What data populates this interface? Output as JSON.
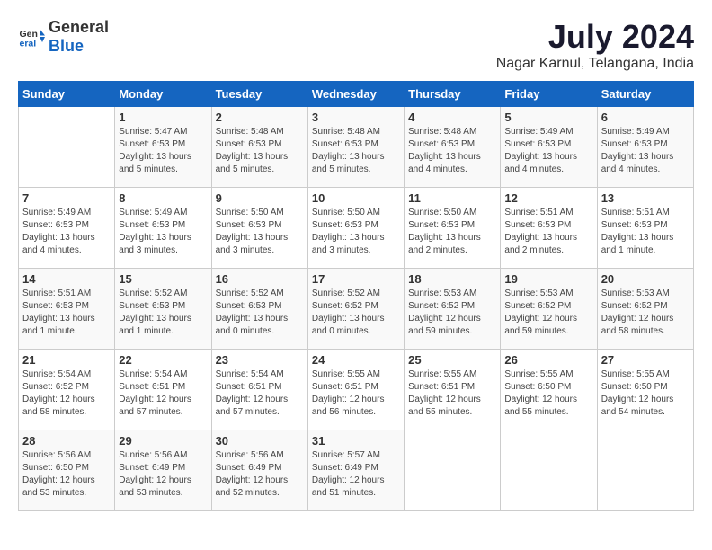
{
  "header": {
    "logo_general": "General",
    "logo_blue": "Blue",
    "month": "July 2024",
    "location": "Nagar Karnul, Telangana, India"
  },
  "weekdays": [
    "Sunday",
    "Monday",
    "Tuesday",
    "Wednesday",
    "Thursday",
    "Friday",
    "Saturday"
  ],
  "weeks": [
    [
      {
        "day": "",
        "info": ""
      },
      {
        "day": "1",
        "info": "Sunrise: 5:47 AM\nSunset: 6:53 PM\nDaylight: 13 hours\nand 5 minutes."
      },
      {
        "day": "2",
        "info": "Sunrise: 5:48 AM\nSunset: 6:53 PM\nDaylight: 13 hours\nand 5 minutes."
      },
      {
        "day": "3",
        "info": "Sunrise: 5:48 AM\nSunset: 6:53 PM\nDaylight: 13 hours\nand 5 minutes."
      },
      {
        "day": "4",
        "info": "Sunrise: 5:48 AM\nSunset: 6:53 PM\nDaylight: 13 hours\nand 4 minutes."
      },
      {
        "day": "5",
        "info": "Sunrise: 5:49 AM\nSunset: 6:53 PM\nDaylight: 13 hours\nand 4 minutes."
      },
      {
        "day": "6",
        "info": "Sunrise: 5:49 AM\nSunset: 6:53 PM\nDaylight: 13 hours\nand 4 minutes."
      }
    ],
    [
      {
        "day": "7",
        "info": "Sunrise: 5:49 AM\nSunset: 6:53 PM\nDaylight: 13 hours\nand 4 minutes."
      },
      {
        "day": "8",
        "info": "Sunrise: 5:49 AM\nSunset: 6:53 PM\nDaylight: 13 hours\nand 3 minutes."
      },
      {
        "day": "9",
        "info": "Sunrise: 5:50 AM\nSunset: 6:53 PM\nDaylight: 13 hours\nand 3 minutes."
      },
      {
        "day": "10",
        "info": "Sunrise: 5:50 AM\nSunset: 6:53 PM\nDaylight: 13 hours\nand 3 minutes."
      },
      {
        "day": "11",
        "info": "Sunrise: 5:50 AM\nSunset: 6:53 PM\nDaylight: 13 hours\nand 2 minutes."
      },
      {
        "day": "12",
        "info": "Sunrise: 5:51 AM\nSunset: 6:53 PM\nDaylight: 13 hours\nand 2 minutes."
      },
      {
        "day": "13",
        "info": "Sunrise: 5:51 AM\nSunset: 6:53 PM\nDaylight: 13 hours\nand 1 minute."
      }
    ],
    [
      {
        "day": "14",
        "info": "Sunrise: 5:51 AM\nSunset: 6:53 PM\nDaylight: 13 hours\nand 1 minute."
      },
      {
        "day": "15",
        "info": "Sunrise: 5:52 AM\nSunset: 6:53 PM\nDaylight: 13 hours\nand 1 minute."
      },
      {
        "day": "16",
        "info": "Sunrise: 5:52 AM\nSunset: 6:53 PM\nDaylight: 13 hours\nand 0 minutes."
      },
      {
        "day": "17",
        "info": "Sunrise: 5:52 AM\nSunset: 6:52 PM\nDaylight: 13 hours\nand 0 minutes."
      },
      {
        "day": "18",
        "info": "Sunrise: 5:53 AM\nSunset: 6:52 PM\nDaylight: 12 hours\nand 59 minutes."
      },
      {
        "day": "19",
        "info": "Sunrise: 5:53 AM\nSunset: 6:52 PM\nDaylight: 12 hours\nand 59 minutes."
      },
      {
        "day": "20",
        "info": "Sunrise: 5:53 AM\nSunset: 6:52 PM\nDaylight: 12 hours\nand 58 minutes."
      }
    ],
    [
      {
        "day": "21",
        "info": "Sunrise: 5:54 AM\nSunset: 6:52 PM\nDaylight: 12 hours\nand 58 minutes."
      },
      {
        "day": "22",
        "info": "Sunrise: 5:54 AM\nSunset: 6:51 PM\nDaylight: 12 hours\nand 57 minutes."
      },
      {
        "day": "23",
        "info": "Sunrise: 5:54 AM\nSunset: 6:51 PM\nDaylight: 12 hours\nand 57 minutes."
      },
      {
        "day": "24",
        "info": "Sunrise: 5:55 AM\nSunset: 6:51 PM\nDaylight: 12 hours\nand 56 minutes."
      },
      {
        "day": "25",
        "info": "Sunrise: 5:55 AM\nSunset: 6:51 PM\nDaylight: 12 hours\nand 55 minutes."
      },
      {
        "day": "26",
        "info": "Sunrise: 5:55 AM\nSunset: 6:50 PM\nDaylight: 12 hours\nand 55 minutes."
      },
      {
        "day": "27",
        "info": "Sunrise: 5:55 AM\nSunset: 6:50 PM\nDaylight: 12 hours\nand 54 minutes."
      }
    ],
    [
      {
        "day": "28",
        "info": "Sunrise: 5:56 AM\nSunset: 6:50 PM\nDaylight: 12 hours\nand 53 minutes."
      },
      {
        "day": "29",
        "info": "Sunrise: 5:56 AM\nSunset: 6:49 PM\nDaylight: 12 hours\nand 53 minutes."
      },
      {
        "day": "30",
        "info": "Sunrise: 5:56 AM\nSunset: 6:49 PM\nDaylight: 12 hours\nand 52 minutes."
      },
      {
        "day": "31",
        "info": "Sunrise: 5:57 AM\nSunset: 6:49 PM\nDaylight: 12 hours\nand 51 minutes."
      },
      {
        "day": "",
        "info": ""
      },
      {
        "day": "",
        "info": ""
      },
      {
        "day": "",
        "info": ""
      }
    ]
  ]
}
